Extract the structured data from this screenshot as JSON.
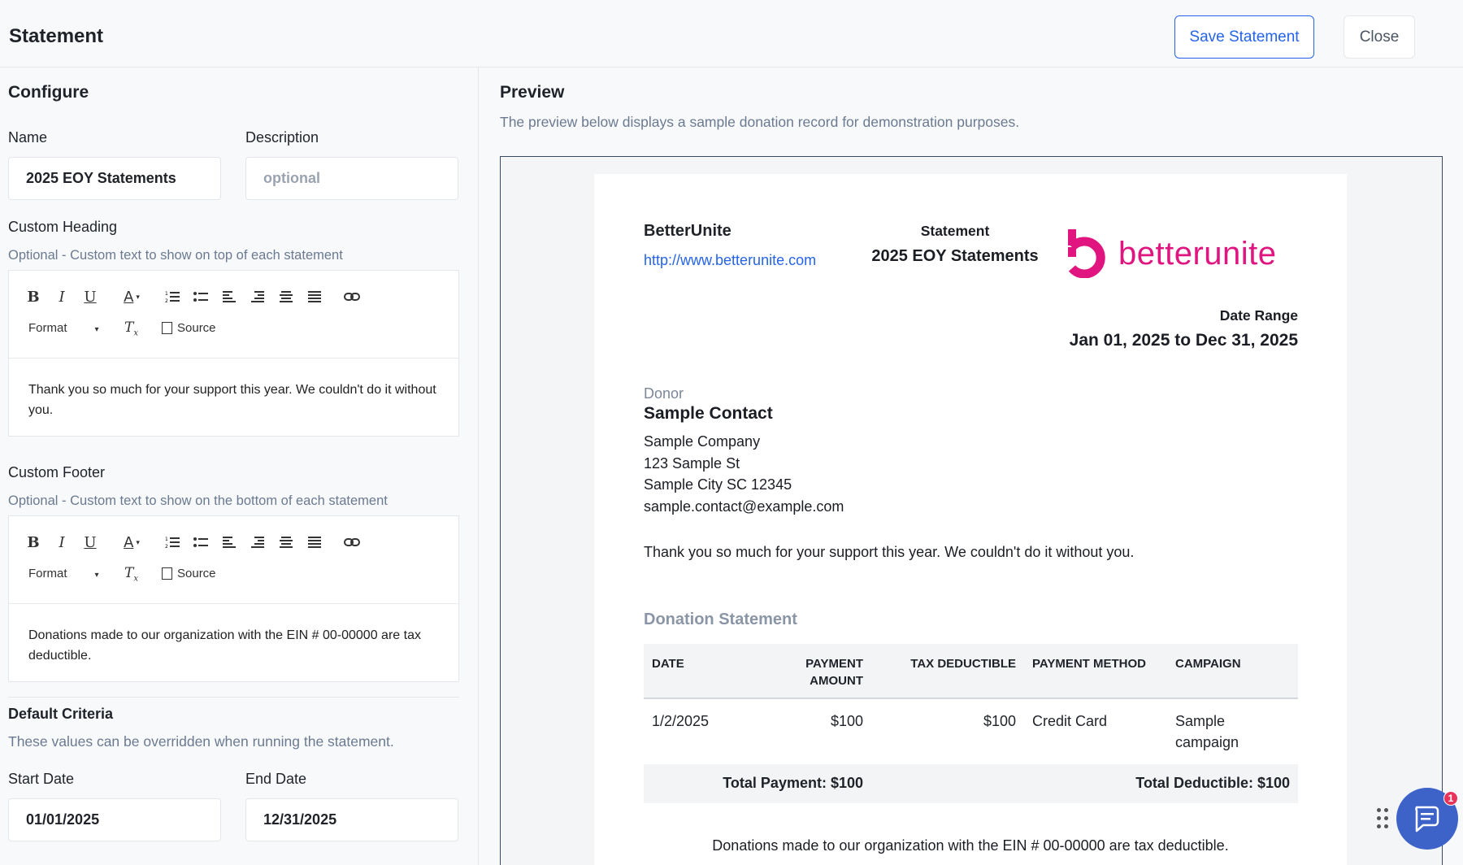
{
  "header": {
    "title": "Statement",
    "save_label": "Save Statement",
    "close_label": "Close"
  },
  "configure": {
    "heading": "Configure",
    "name_label": "Name",
    "name_value": "2025 EOY Statements",
    "description_label": "Description",
    "description_placeholder": "optional",
    "custom_heading_label": "Custom Heading",
    "custom_heading_sub": "Optional - Custom text to show on top of each statement",
    "custom_heading_text": "Thank you so much for your support this year. We couldn't do it without you.",
    "custom_footer_label": "Custom Footer",
    "custom_footer_sub": "Optional - Custom text to show on the bottom of each statement",
    "custom_footer_text": "Donations made to our organization with the EIN # 00-00000 are tax deductible.",
    "toolbar": {
      "format_label": "Format",
      "source_label": "Source"
    },
    "default_criteria_label": "Default Criteria",
    "default_criteria_sub": "These values can be overridden when running the statement.",
    "start_date_label": "Start Date",
    "start_date_value": "01/01/2025",
    "end_date_label": "End Date",
    "end_date_value": "12/31/2025"
  },
  "preview": {
    "heading": "Preview",
    "sub": "The preview below displays a sample donation record for demonstration purposes.",
    "org_name": "BetterUnite",
    "org_url": "http://www.betterunite.com",
    "statement_label": "Statement",
    "statement_name": "2025 EOY Statements",
    "logo_text": "betterunite",
    "date_range_label": "Date Range",
    "date_range_value": "Jan 01, 2025 to Dec 31, 2025",
    "donor_label": "Donor",
    "donor_name": "Sample Contact",
    "donor_company": "Sample Company",
    "donor_street": "123 Sample St",
    "donor_city": "Sample City SC 12345",
    "donor_email": "sample.contact@example.com",
    "heading_text": "Thank you so much for your support this year. We couldn't do it without you.",
    "donation_statement_title": "Donation Statement",
    "table": {
      "headers": [
        "DATE",
        "PAYMENT AMOUNT",
        "TAX DEDUCTIBLE",
        "PAYMENT METHOD",
        "CAMPAIGN"
      ],
      "rows": [
        [
          "1/2/2025",
          "$100",
          "$100",
          "Credit Card",
          "Sample campaign"
        ]
      ],
      "total_payment": "Total Payment: $100",
      "total_deductible": "Total Deductible: $100"
    },
    "footer_text": "Donations made to our organization with the EIN # 00-00000 are tax deductible."
  },
  "chat": {
    "badge_count": "1"
  },
  "colors": {
    "accent": "#2563eb",
    "brand": "#e0157f",
    "chat": "#3d63c9"
  }
}
